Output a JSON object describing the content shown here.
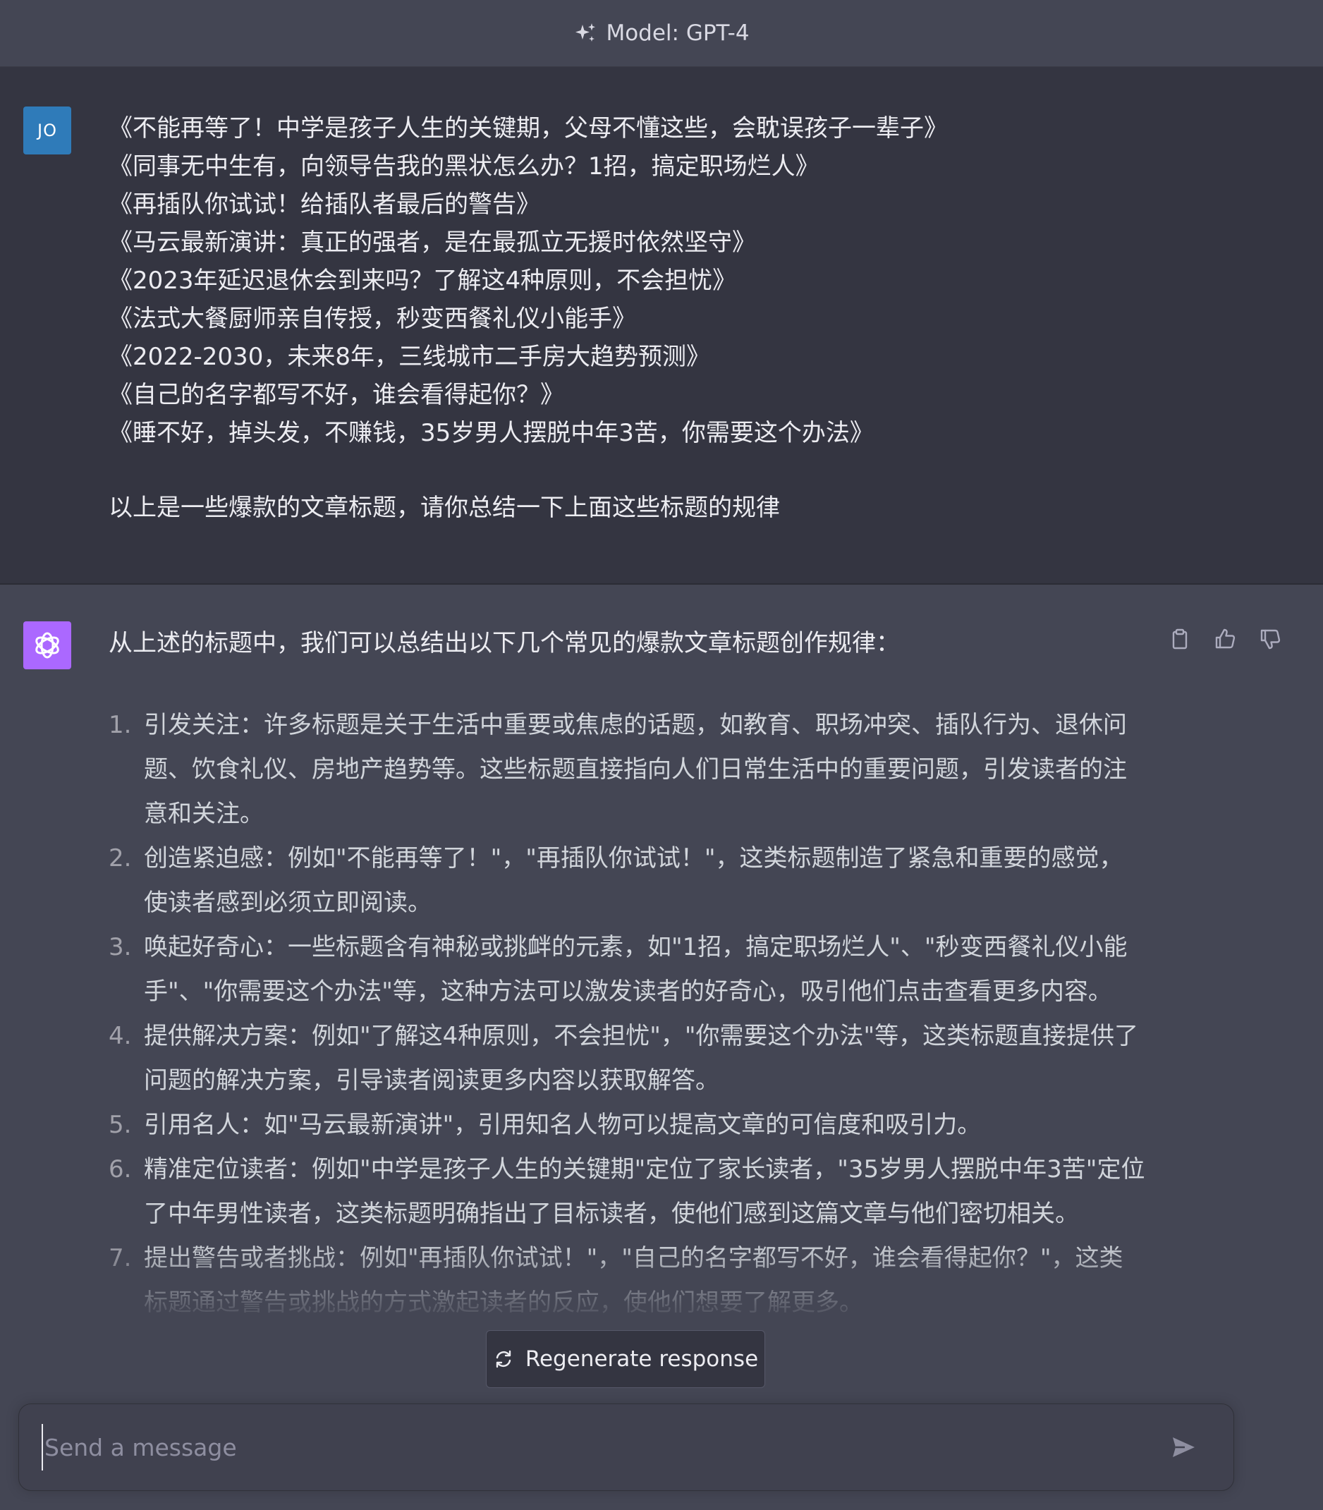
{
  "header": {
    "model_label": "Model: GPT-4",
    "icon": "sparkles-icon"
  },
  "user_message": {
    "avatar_initials": "JO",
    "lines": [
      "《不能再等了！中学是孩子人生的关键期，父母不懂这些，会耽误孩子一辈子》",
      "《同事无中生有，向领导告我的黑状怎么办？1招，搞定职场烂人》",
      "《再插队你试试！给插队者最后的警告》",
      "《马云最新演讲：真正的强者，是在最孤立无援时依然坚守》",
      "《2023年延迟退休会到来吗？了解这4种原则，不会担忧》",
      "《法式大餐厨师亲自传授，秒变西餐礼仪小能手》",
      "《2022-2030，未来8年，三线城市二手房大趋势预测》",
      "《自己的名字都写不好，谁会看得起你？》",
      "《睡不好，掉头发，不赚钱，35岁男人摆脱中年3苦，你需要这个办法》"
    ],
    "question": "以上是一些爆款的文章标题，请你总结一下上面这些标题的规律"
  },
  "assistant_message": {
    "avatar_icon": "openai-logo-icon",
    "intro": "从上述的标题中，我们可以总结出以下几个常见的爆款文章标题创作规律：",
    "items": [
      {
        "num": "1.",
        "text": "引发关注：许多标题是关于生活中重要或焦虑的话题，如教育、职场冲突、插队行为、退休问题、饮食礼仪、房地产趋势等。这些标题直接指向人们日常生活中的重要问题，引发读者的注意和关注。"
      },
      {
        "num": "2.",
        "text": "创造紧迫感：例如\"不能再等了！\"，\"再插队你试试！\"，这类标题制造了紧急和重要的感觉，使读者感到必须立即阅读。"
      },
      {
        "num": "3.",
        "text": "唤起好奇心：一些标题含有神秘或挑衅的元素，如\"1招，搞定职场烂人\"、\"秒变西餐礼仪小能手\"、\"你需要这个办法\"等，这种方法可以激发读者的好奇心，吸引他们点击查看更多内容。"
      },
      {
        "num": "4.",
        "text": "提供解决方案：例如\"了解这4种原则，不会担忧\"，\"你需要这个办法\"等，这类标题直接提供了问题的解决方案，引导读者阅读更多内容以获取解答。"
      },
      {
        "num": "5.",
        "text": "引用名人：如\"马云最新演讲\"，引用知名人物可以提高文章的可信度和吸引力。"
      },
      {
        "num": "6.",
        "text": "精准定位读者：例如\"中学是孩子人生的关键期\"定位了家长读者，\"35岁男人摆脱中年3苦\"定位了中年男性读者，这类标题明确指出了目标读者，使他们感到这篇文章与他们密切相关。"
      },
      {
        "num": "7.",
        "text": "提出警告或者挑战：例如\"再插队你试试！\"，\"自己的名字都写不好，谁会看得起你？\"，这类标题通过警告或挑战的方式激起读者的反应，使他们想要了解更多。"
      }
    ],
    "actions": [
      "clipboard-icon",
      "thumbs-up-icon",
      "thumbs-down-icon"
    ]
  },
  "regenerate": {
    "label": "Regenerate response",
    "icon": "refresh-icon"
  },
  "composer": {
    "placeholder": "Send a message",
    "value": "",
    "send_icon": "send-icon"
  },
  "colors": {
    "header_bg": "#444654",
    "user_bg": "#343541",
    "assistant_bg": "#444654",
    "user_avatar": "#2f7bb9",
    "gpt_avatar": "#ab68ff",
    "text": "#ececf1",
    "muted": "#8e8ea0"
  }
}
